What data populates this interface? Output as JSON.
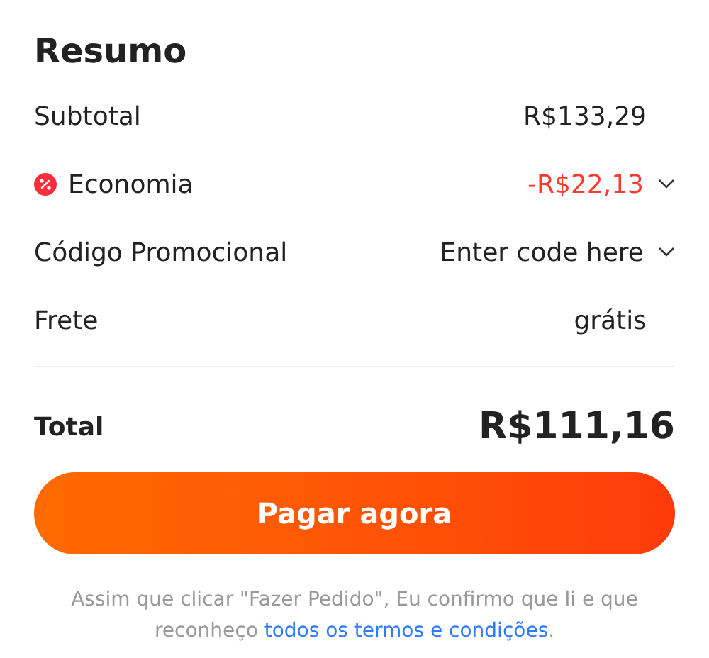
{
  "title": "Resumo",
  "rows": [
    {
      "kind": "plain",
      "label": "Subtotal",
      "value": "R$133,29"
    },
    {
      "kind": "discount",
      "label": "Economia",
      "value": "-R$22,13",
      "expanded": false
    },
    {
      "kind": "promo",
      "label": "Código Promocional",
      "placeholder": "Enter code here",
      "expanded": false
    },
    {
      "kind": "plain",
      "label": "Frete",
      "value": "grátis"
    }
  ],
  "total": {
    "label": "Total",
    "value": "R$111,16"
  },
  "pay_button": "Pagar agora",
  "notice": {
    "text": "Assim que clicar \"Fazer Pedido\", Eu confirmo que li e que reconheço ",
    "link": "todos os termos e condições",
    "end": "."
  }
}
